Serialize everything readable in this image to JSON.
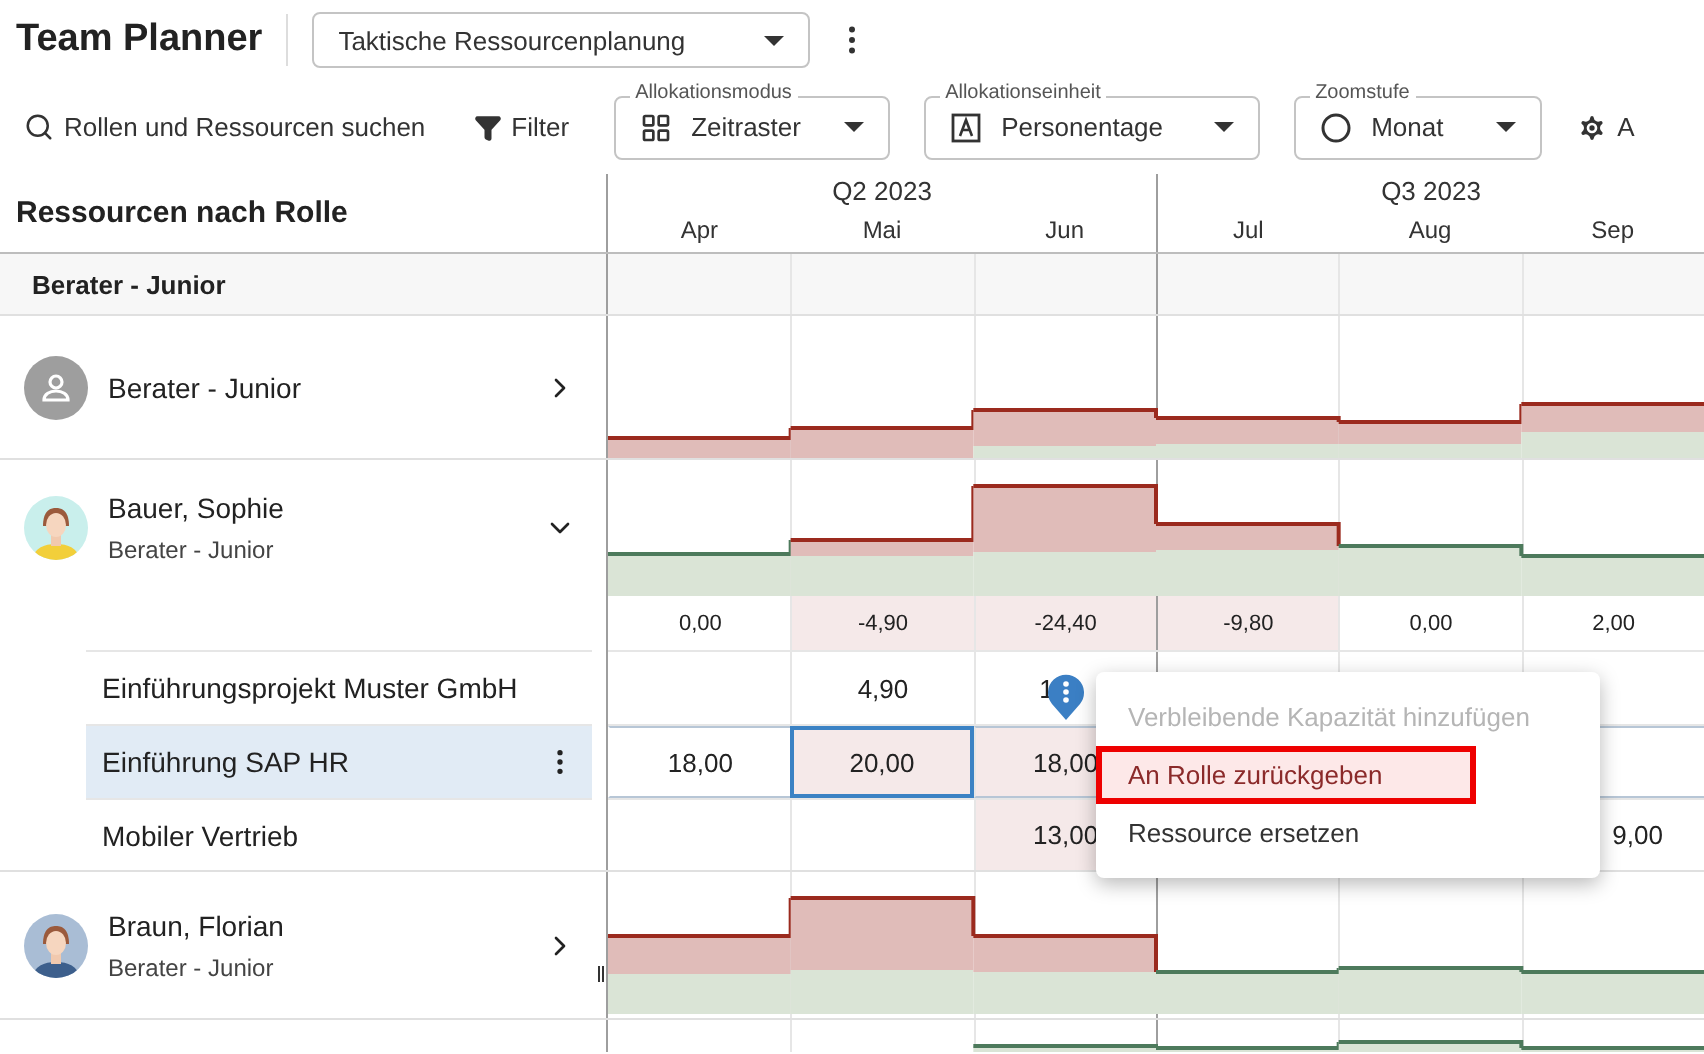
{
  "app": {
    "title": "Team Planner",
    "view_select": "Taktische Ressourcenplanung"
  },
  "toolbar": {
    "search": "Rollen und Ressourcen suchen",
    "filter": "Filter",
    "selects": [
      {
        "kind": "grid",
        "label": "Allokationsmodus",
        "value": "Zeitraster"
      },
      {
        "kind": "letter",
        "label": "Allokationseinheit",
        "value": "Personentage"
      },
      {
        "kind": "moon",
        "label": "Zoomstufe",
        "value": "Monat"
      }
    ],
    "settings": "A"
  },
  "timeline": {
    "heading": "Ressourcen nach Rolle",
    "quarters": [
      "Q2 2023",
      "Q3 2023"
    ],
    "months": [
      "Apr",
      "Mai",
      "Jun",
      "Jul",
      "Aug",
      "Sep"
    ]
  },
  "group": {
    "label": "Berater - Junior"
  },
  "rows": [
    {
      "kind": "role",
      "name": "Berater - Junior",
      "expanded": false
    },
    {
      "kind": "person",
      "name": "Bauer, Sophie",
      "role": "Berater - Junior",
      "expanded": true,
      "totals": [
        {
          "value": "0,00",
          "over": false
        },
        {
          "value": "-4,90",
          "over": true
        },
        {
          "value": "-24,40",
          "over": true
        },
        {
          "value": "-9,80",
          "over": true
        },
        {
          "value": "0,00",
          "over": false
        },
        {
          "value": "2,00",
          "over": false
        }
      ],
      "assignments": [
        {
          "name": "Einführungsprojekt Muster GmbH",
          "selected": false,
          "cells": [
            {
              "over": false,
              "selected": false
            },
            {
              "value": "4,90",
              "over": false,
              "selected": false
            },
            {
              "value": "1",
              "over": false,
              "selected": false
            },
            {},
            {},
            {
              "over": false,
              "selected": false
            }
          ]
        },
        {
          "name": "Einführung SAP HR",
          "selected": true,
          "cells": [
            {
              "value": "18,00",
              "over": false,
              "selected": false
            },
            {
              "value": "20,00",
              "over": true,
              "selected": true
            },
            {
              "value": "18,00",
              "over": true,
              "selected": false
            },
            {},
            {},
            {
              "over": false,
              "selected": false
            }
          ]
        },
        {
          "name": "Mobiler Vertrieb",
          "selected": false,
          "cells": [
            {
              "over": false,
              "selected": false
            },
            {
              "over": false,
              "selected": false
            },
            {
              "value": "13,00",
              "over": true,
              "selected": false
            },
            {},
            {},
            {
              "value": "9,00",
              "over": false,
              "selected": false
            }
          ]
        }
      ]
    },
    {
      "kind": "person",
      "name": "Braun, Florian",
      "role": "Berater - Junior",
      "expanded": false
    },
    {
      "kind": "partial"
    }
  ],
  "context_menu": {
    "items": [
      {
        "label": "Verbleibende Kapazität hinzufügen",
        "disabled": true,
        "highlighted": false
      },
      {
        "label": "An Rolle zurückgeben",
        "disabled": false,
        "highlighted": true
      },
      {
        "label": "Ressource ersetzen",
        "disabled": false,
        "highlighted": false
      }
    ]
  }
}
